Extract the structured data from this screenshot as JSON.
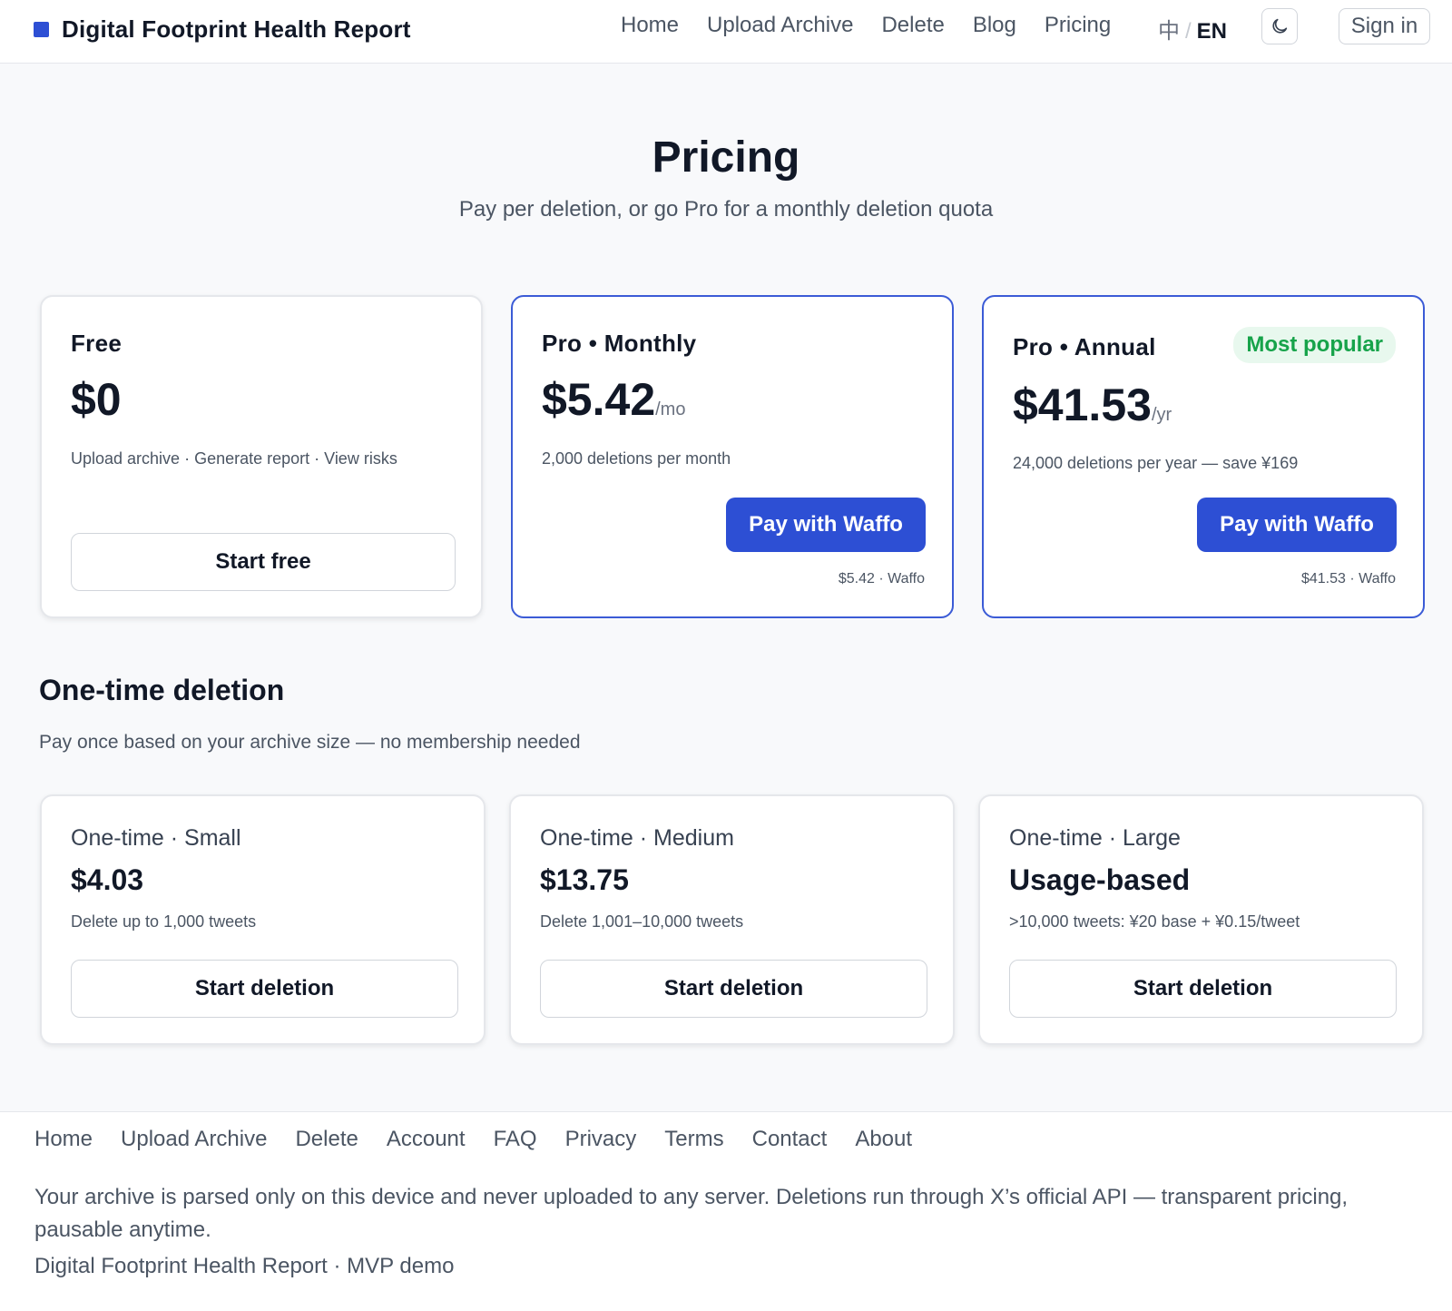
{
  "header": {
    "brand_title": "Digital Footprint Health Report",
    "nav": [
      "Home",
      "Upload Archive",
      "Delete",
      "Blog",
      "Pricing"
    ],
    "lang_zh": "中",
    "lang_sep": "/",
    "lang_en": "EN",
    "theme_icon": "moon-icon",
    "sign_in": "Sign in"
  },
  "hero": {
    "title": "Pricing",
    "subtitle": "Pay per deletion, or go Pro for a monthly deletion quota"
  },
  "plans": [
    {
      "name": "Free",
      "price": "$0",
      "unit": "",
      "desc": "Upload archive · Generate report · View risks",
      "button": "Start free"
    },
    {
      "name": "Pro • Monthly",
      "price": "$5.42",
      "unit": "/mo",
      "desc": "2,000 deletions per month",
      "button": "Pay with Waffo",
      "note": "$5.42 · Waffo"
    },
    {
      "name": "Pro • Annual",
      "badge": "Most popular",
      "price": "$41.53",
      "unit": "/yr",
      "desc": "24,000 deletions per year — save ¥169",
      "button": "Pay with Waffo",
      "note": "$41.53 · Waffo"
    }
  ],
  "one_time": {
    "title": "One-time deletion",
    "subtitle": "Pay once based on your archive size — no membership needed",
    "items": [
      {
        "name": "One-time · Small",
        "price": "$4.03",
        "desc": "Delete up to 1,000 tweets",
        "button": "Start deletion"
      },
      {
        "name": "One-time · Medium",
        "price": "$13.75",
        "desc": "Delete 1,001–10,000 tweets",
        "button": "Start deletion"
      },
      {
        "name": "One-time · Large",
        "price": "Usage-based",
        "desc": ">10,000 tweets: ¥20 base + ¥0.15/tweet",
        "button": "Start deletion"
      }
    ]
  },
  "footer": {
    "links": [
      "Home",
      "Upload Archive",
      "Delete",
      "Account",
      "FAQ",
      "Privacy",
      "Terms",
      "Contact",
      "About"
    ],
    "note": "Your archive is parsed only on this device and never uploaded to any server. Deletions run through X’s official API — transparent pricing, pausable anytime.",
    "copyright": "Digital Footprint Health Report · MVP demo"
  },
  "colors": {
    "accent": "#2d4fd4",
    "badge_text": "#16a34a",
    "badge_bg": "#e8f8ee",
    "page_bg": "#f8f9fb"
  }
}
